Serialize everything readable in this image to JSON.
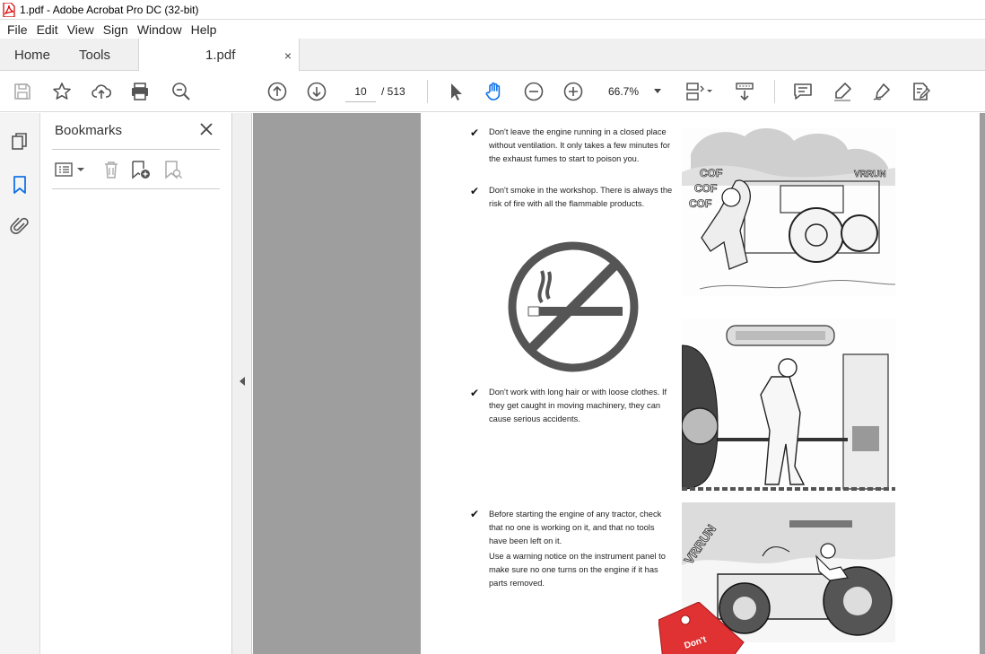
{
  "window": {
    "title": "1.pdf - Adobe Acrobat Pro DC (32-bit)"
  },
  "menu": [
    "File",
    "Edit",
    "View",
    "Sign",
    "Window",
    "Help"
  ],
  "tabs": {
    "home": "Home",
    "tools": "Tools",
    "doc": "1.pdf",
    "close": "×"
  },
  "toolbar": {
    "page_current": "10",
    "page_total": "/ 513",
    "zoom": "66.7%"
  },
  "bookmarks": {
    "title": "Bookmarks"
  },
  "document": {
    "items": [
      {
        "check": "✔",
        "text": "Don't leave the engine running in a closed place without ventilation. It only takes a few minutes for the exhaust fumes to start to poison you."
      },
      {
        "check": "✔",
        "text": "Don't smoke in the workshop. There is always the risk of fire with all the flammable products."
      },
      {
        "check": "✔",
        "text": "Don't work with long hair or with loose clothes. If they get caught in moving machinery, they can cause serious accidents."
      },
      {
        "check": "✔",
        "text": "Before starting the engine of any tractor, check that no one is working on it, and that no tools have been left on it."
      },
      {
        "check": "",
        "text": "Use a warning notice on the instrument panel to make sure no one turns on the engine if it has parts removed."
      }
    ],
    "illustration_text": {
      "cough": [
        "COF",
        "COF",
        "COF"
      ],
      "vroom": "VRRUN",
      "vroom2": "VRRUN",
      "tag": "Don't"
    }
  }
}
